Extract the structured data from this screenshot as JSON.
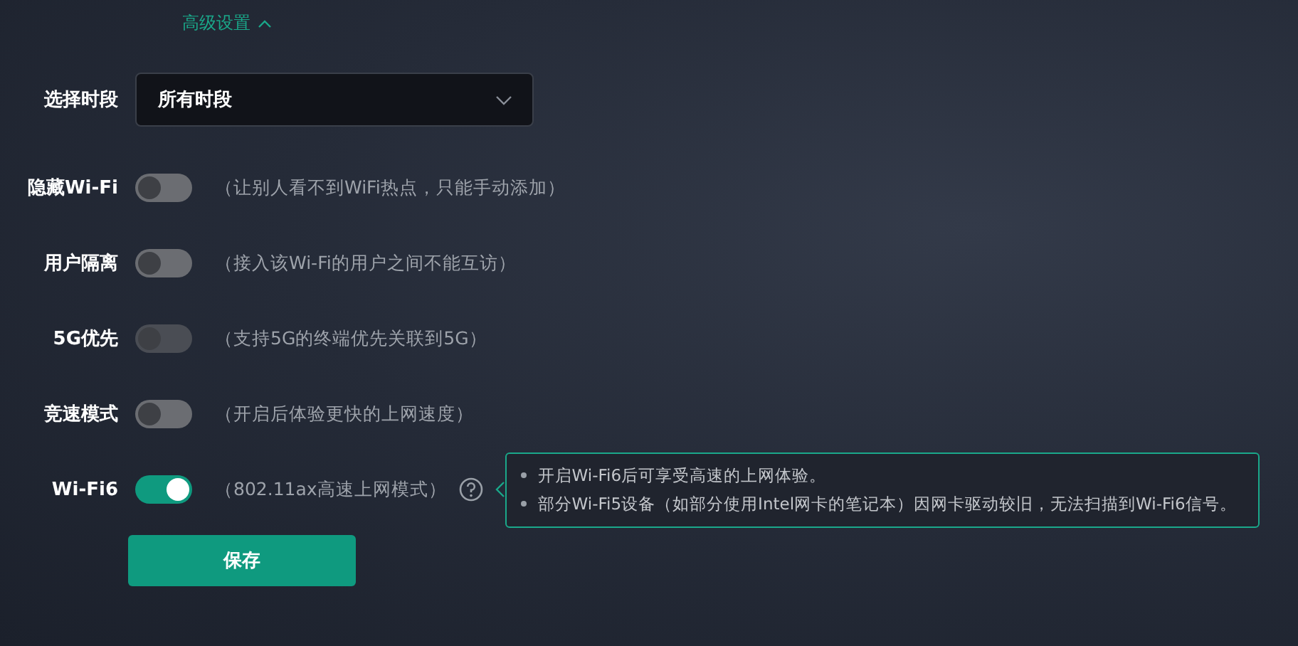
{
  "advanced": {
    "label": "高级设置",
    "expanded": true
  },
  "time_period": {
    "label": "选择时段",
    "value": "所有时段"
  },
  "toggles": [
    {
      "label": "隐藏Wi-Fi",
      "on": false,
      "disabled": false,
      "hint": "（让别人看不到WiFi热点，只能手动添加）"
    },
    {
      "label": "用户隔离",
      "on": false,
      "disabled": false,
      "hint": "（接入该Wi-Fi的用户之间不能互访）"
    },
    {
      "label": "5G优先",
      "on": false,
      "disabled": true,
      "hint": "（支持5G的终端优先关联到5G）"
    },
    {
      "label": "竞速模式",
      "on": false,
      "disabled": false,
      "hint": "（开启后体验更快的上网速度）"
    },
    {
      "label": "Wi-Fi6",
      "on": true,
      "disabled": false,
      "hint": "（802.11ax高速上网模式）",
      "help": true
    }
  ],
  "tooltip": [
    "开启Wi-Fi6后可享受高速的上网体验。",
    "部分Wi-Fi5设备（如部分使用Intel网卡的笔记本）因网卡驱动较旧，无法扫描到Wi-Fi6信号。"
  ],
  "save_button": "保存"
}
